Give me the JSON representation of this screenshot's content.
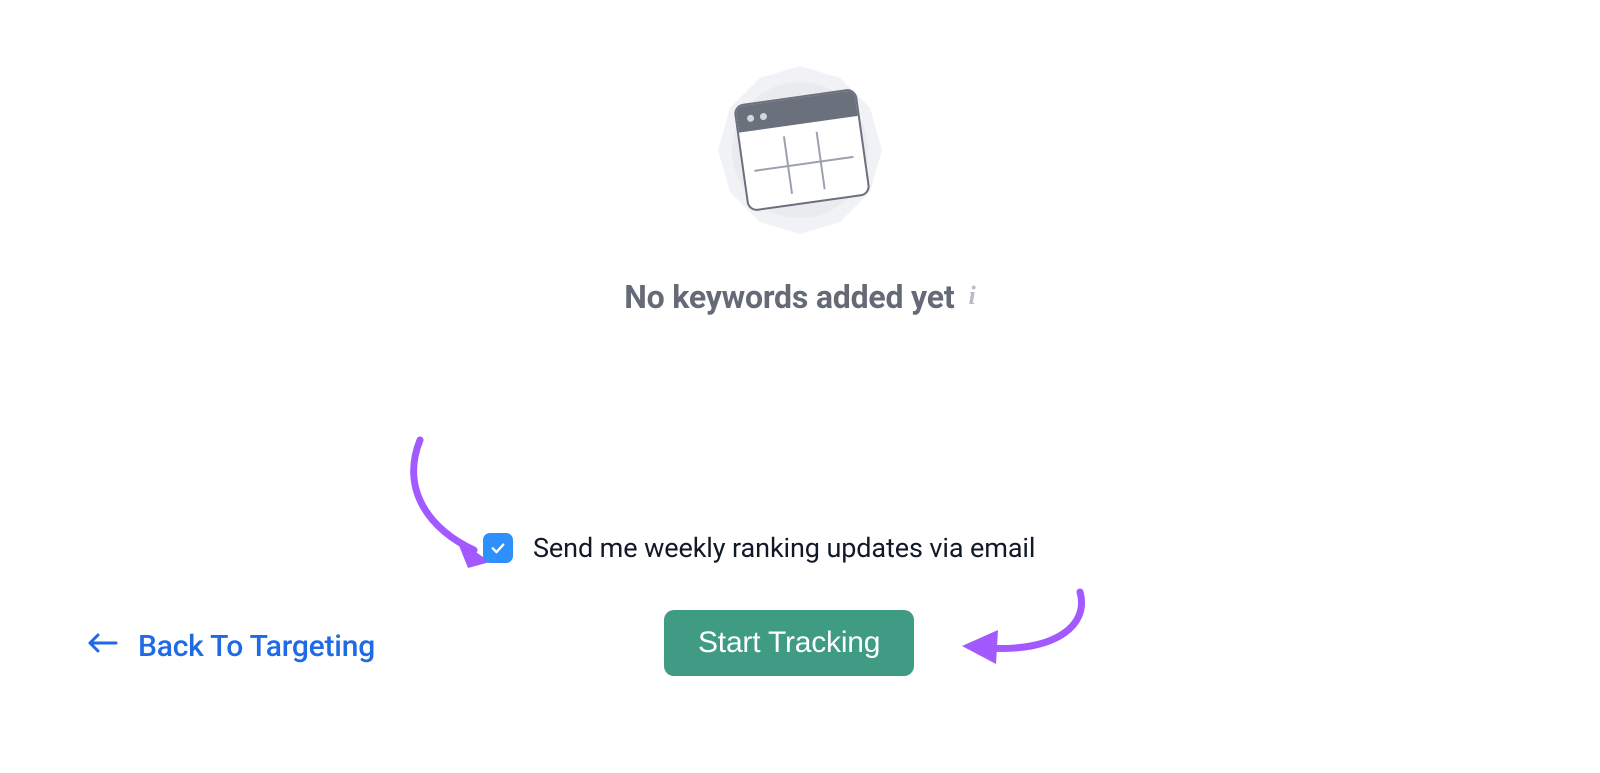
{
  "empty_state": {
    "heading": "No keywords added yet",
    "info_icon_glyph": "i"
  },
  "checkbox": {
    "checked": true,
    "label": "Send me weekly ranking updates via email"
  },
  "buttons": {
    "back_label": "Back To Targeting",
    "start_label": "Start Tracking"
  },
  "colors": {
    "accent_blue": "#2E90FA",
    "link_blue": "#1E6BE5",
    "primary_green": "#3F9B83",
    "annotation_purple": "#A259FF"
  }
}
